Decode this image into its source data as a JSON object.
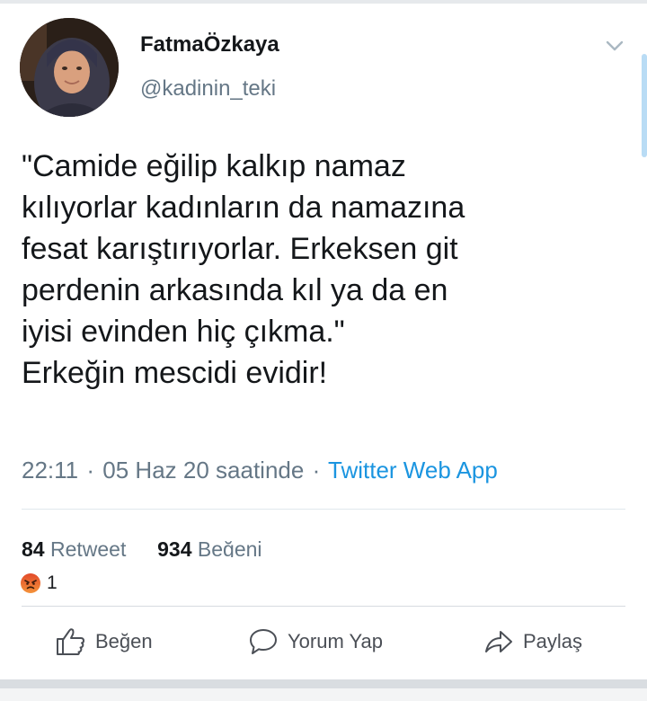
{
  "profile": {
    "display_name": "FatmaÖzkaya",
    "handle": "@kadinin_teki",
    "avatar_icon": "profile-photo"
  },
  "tweet": {
    "lines": [
      "\"Camide eğilip kalkıp namaz",
      "kılıyorlar kadınların da namazına",
      "fesat karıştırıyorlar. Erkeksen git",
      "perdenin arkasında kıl ya da en",
      "iyisi evinden hiç çıkma.\"",
      "Erkeğin mescidi evidir!"
    ],
    "time": "22:11",
    "separator": "·",
    "date_text": "05 Haz 20 saatinde",
    "source": "Twitter Web App"
  },
  "stats": {
    "retweets_count": "84",
    "retweets_label": "Retweet",
    "likes_count": "934",
    "likes_label": "Beğeni"
  },
  "reactions": {
    "icon": "angry-reaction-icon",
    "count": "1"
  },
  "actions": {
    "like_label": "Beğen",
    "comment_label": "Yorum Yap",
    "share_label": "Paylaş"
  },
  "colors": {
    "text": "#14171a",
    "secondary": "#657786",
    "link": "#1b95e0",
    "angry_top": "#f4933a",
    "angry_bottom": "#e24a2a"
  }
}
